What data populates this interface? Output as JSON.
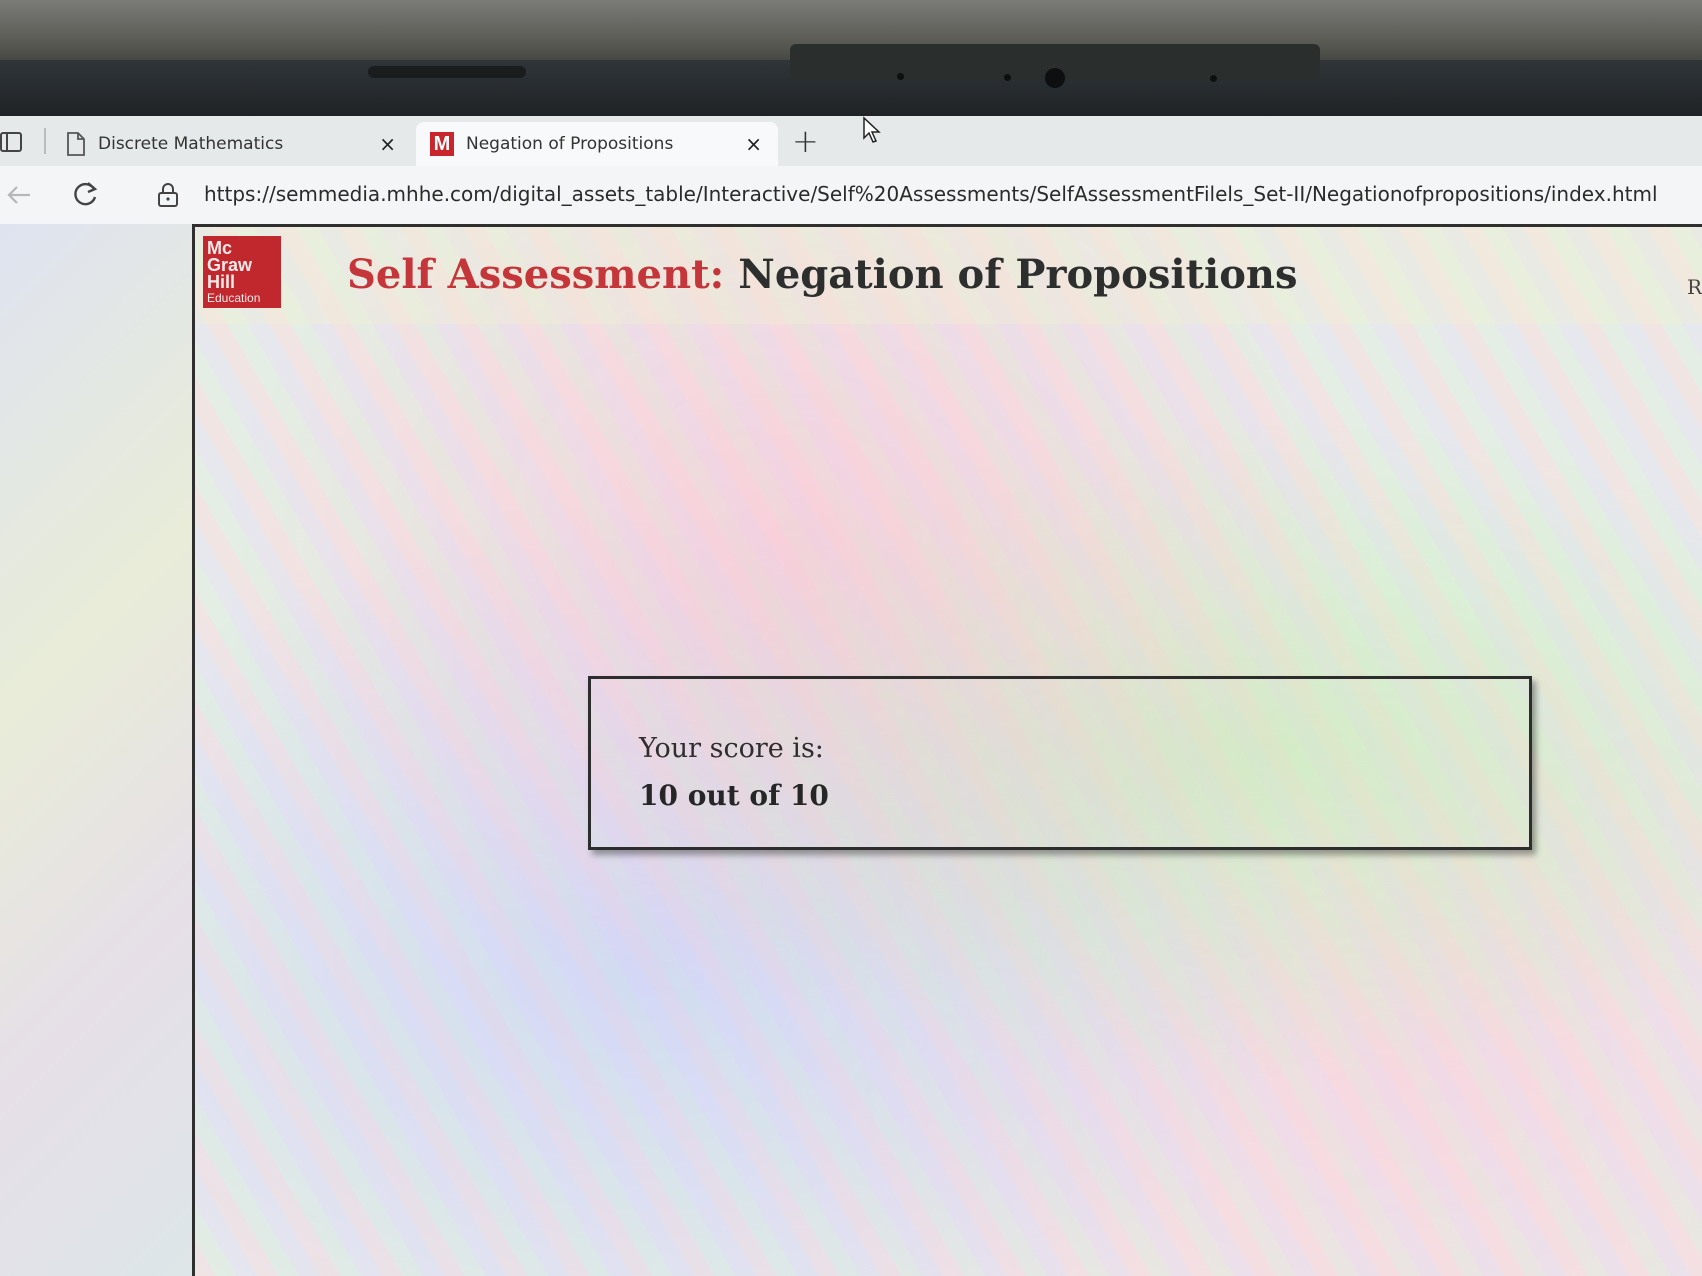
{
  "browser": {
    "tabs": [
      {
        "label": "Discrete Mathematics",
        "close": "×",
        "active": false
      },
      {
        "label": "Negation of Propositions",
        "close": "×",
        "active": true,
        "favicon_letter": "M"
      }
    ],
    "new_tab": "+",
    "url": "https://semmedia.mhhe.com/digital_assets_table/Interactive/Self%20Assessments/SelfAssessmentFilels_Set-II/Negationofpropositions/index.html"
  },
  "page": {
    "logo": {
      "line1": "Mc",
      "line2": "Graw",
      "line3": "Hill",
      "line4": "Education"
    },
    "title_accent": "Self Assessment:",
    "title_main": "Negation of Propositions",
    "edge_letter": "R",
    "score": {
      "label": "Your score is:",
      "value": "10 out of 10"
    }
  },
  "colors": {
    "brand_red": "#c0282e",
    "title_accent": "#c5363a",
    "title_text": "#2d2f2e"
  }
}
